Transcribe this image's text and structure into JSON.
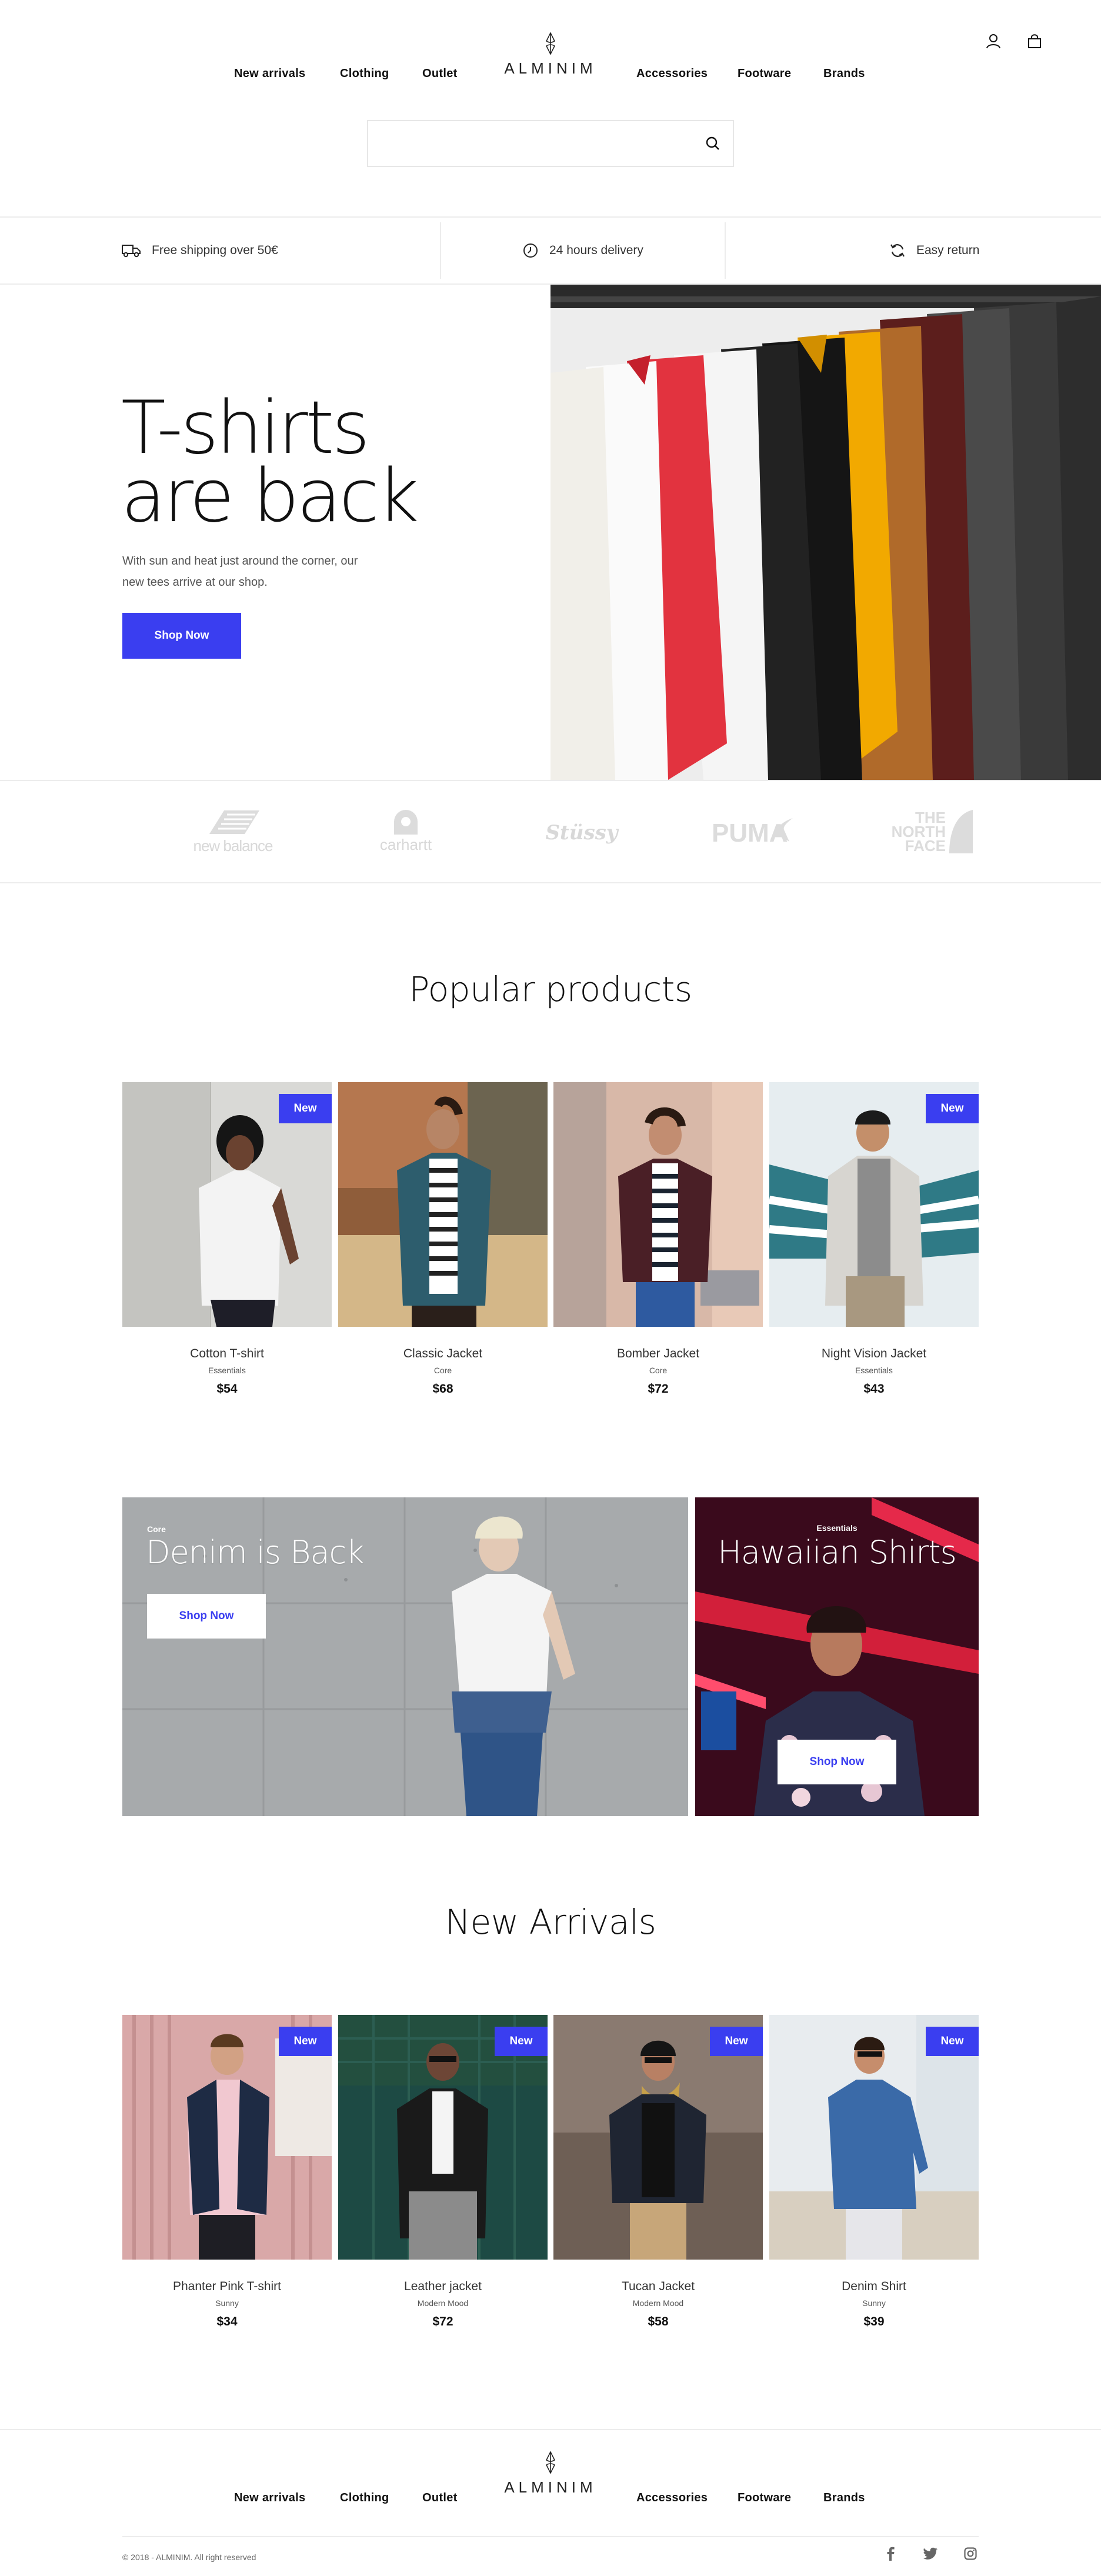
{
  "brand": {
    "name": "ALMINIM"
  },
  "nav": {
    "left": [
      "New arrivals",
      "Clothing",
      "Outlet"
    ],
    "right": [
      "Accessories",
      "Footware",
      "Brands"
    ]
  },
  "header_icons": [
    "user-icon",
    "bag-icon"
  ],
  "search": {
    "placeholder": "",
    "icon": "search-icon"
  },
  "perks": [
    {
      "icon": "truck-icon",
      "label": "Free shipping over 50€"
    },
    {
      "icon": "clock-icon",
      "label": "24 hours delivery"
    },
    {
      "icon": "refresh-icon",
      "label": "Easy return"
    }
  ],
  "hero": {
    "title_line1": "T-shirts",
    "title_line2": "are back",
    "text": "With sun and heat just around the corner, our new tees arrive at our shop.",
    "button": "Shop Now"
  },
  "brands": [
    "new balance",
    "carhartt",
    "Stüssy",
    "PUMA",
    "THE NORTH FACE"
  ],
  "popular": {
    "title": "Popular products",
    "items": [
      {
        "name": "Cotton T-shirt",
        "category": "Essentials",
        "price": "$54",
        "badge": "New"
      },
      {
        "name": "Classic Jacket",
        "category": "Core",
        "price": "$68",
        "badge": ""
      },
      {
        "name": "Bomber Jacket",
        "category": "Core",
        "price": "$72",
        "badge": ""
      },
      {
        "name": "Night Vision Jacket",
        "category": "Essentials",
        "price": "$43",
        "badge": "New"
      }
    ]
  },
  "promos": [
    {
      "tag": "Core",
      "title": "Denim is Back",
      "button": "Shop Now"
    },
    {
      "tag": "Essentials",
      "title": "Hawaiian Shirts",
      "button": "Shop Now"
    }
  ],
  "arrivals": {
    "title": "New Arrivals",
    "items": [
      {
        "name": "Phanter Pink T-shirt",
        "category": "Sunny",
        "price": "$34",
        "badge": "New"
      },
      {
        "name": "Leather jacket",
        "category": "Modern Mood",
        "price": "$72",
        "badge": "New"
      },
      {
        "name": "Tucan Jacket",
        "category": "Modern Mood",
        "price": "$58",
        "badge": "New"
      },
      {
        "name": "Denim Shirt",
        "category": "Sunny",
        "price": "$39",
        "badge": "New"
      }
    ]
  },
  "footer": {
    "copyright": "© 2018 - ALMINIM. All right reserved",
    "social": [
      "facebook-icon",
      "twitter-icon",
      "instagram-icon"
    ]
  },
  "colors": {
    "accent": "#3a3ef0",
    "text": "#111111",
    "border": "#ececec"
  }
}
